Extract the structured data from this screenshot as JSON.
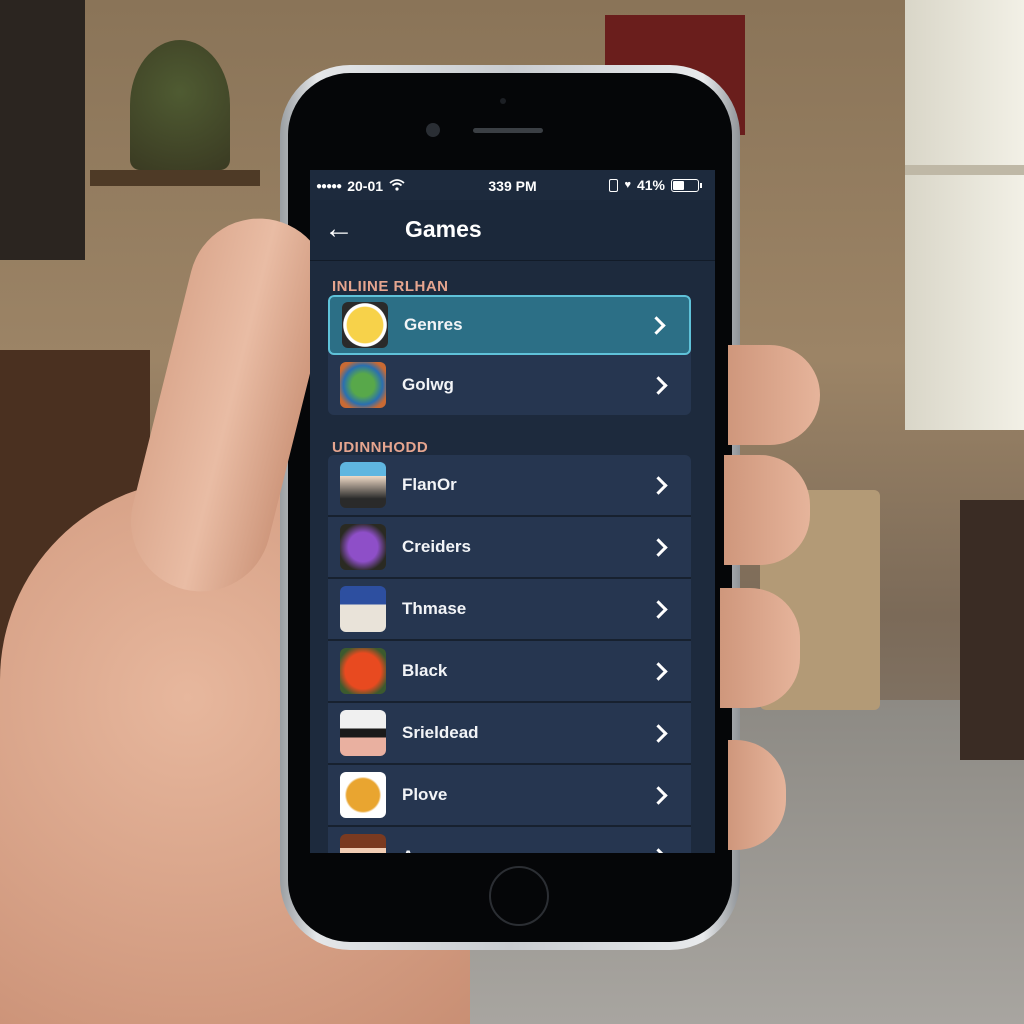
{
  "status_bar": {
    "signal": "●●●●●",
    "carrier": "20-01",
    "wifi_icon": "wifi-icon",
    "time": "339 PM",
    "battery_percent": "41%",
    "battery_level": 0.41
  },
  "nav": {
    "back_icon": "←",
    "title": "Games"
  },
  "sections": [
    {
      "header": "INLIINE RLHAN",
      "items": [
        {
          "label": "Genres",
          "icon": "chick-face-icon",
          "selected": true
        },
        {
          "label": "Golwg",
          "icon": "green-globe-icon",
          "selected": false
        }
      ]
    },
    {
      "header": "UDINNHODD",
      "items": [
        {
          "label": "FlanOr",
          "icon": "princess-icon"
        },
        {
          "label": "Creiders",
          "icon": "purple-monster-icon"
        },
        {
          "label": "Thmase",
          "icon": "blue-knight-icon"
        },
        {
          "label": "Black",
          "icon": "red-demon-icon"
        },
        {
          "label": "Srieldead",
          "icon": "masked-cat-icon"
        },
        {
          "label": "Plove",
          "icon": "golden-badge-icon"
        },
        {
          "label": "Amcer",
          "icon": "character-icon"
        }
      ]
    }
  ],
  "colors": {
    "screen_bg": "#1d2a3d",
    "row_bg": "#263650",
    "selected_bg": "#2c6f86",
    "selected_border": "#5fc2d9",
    "section_header": "#e6a58f"
  }
}
